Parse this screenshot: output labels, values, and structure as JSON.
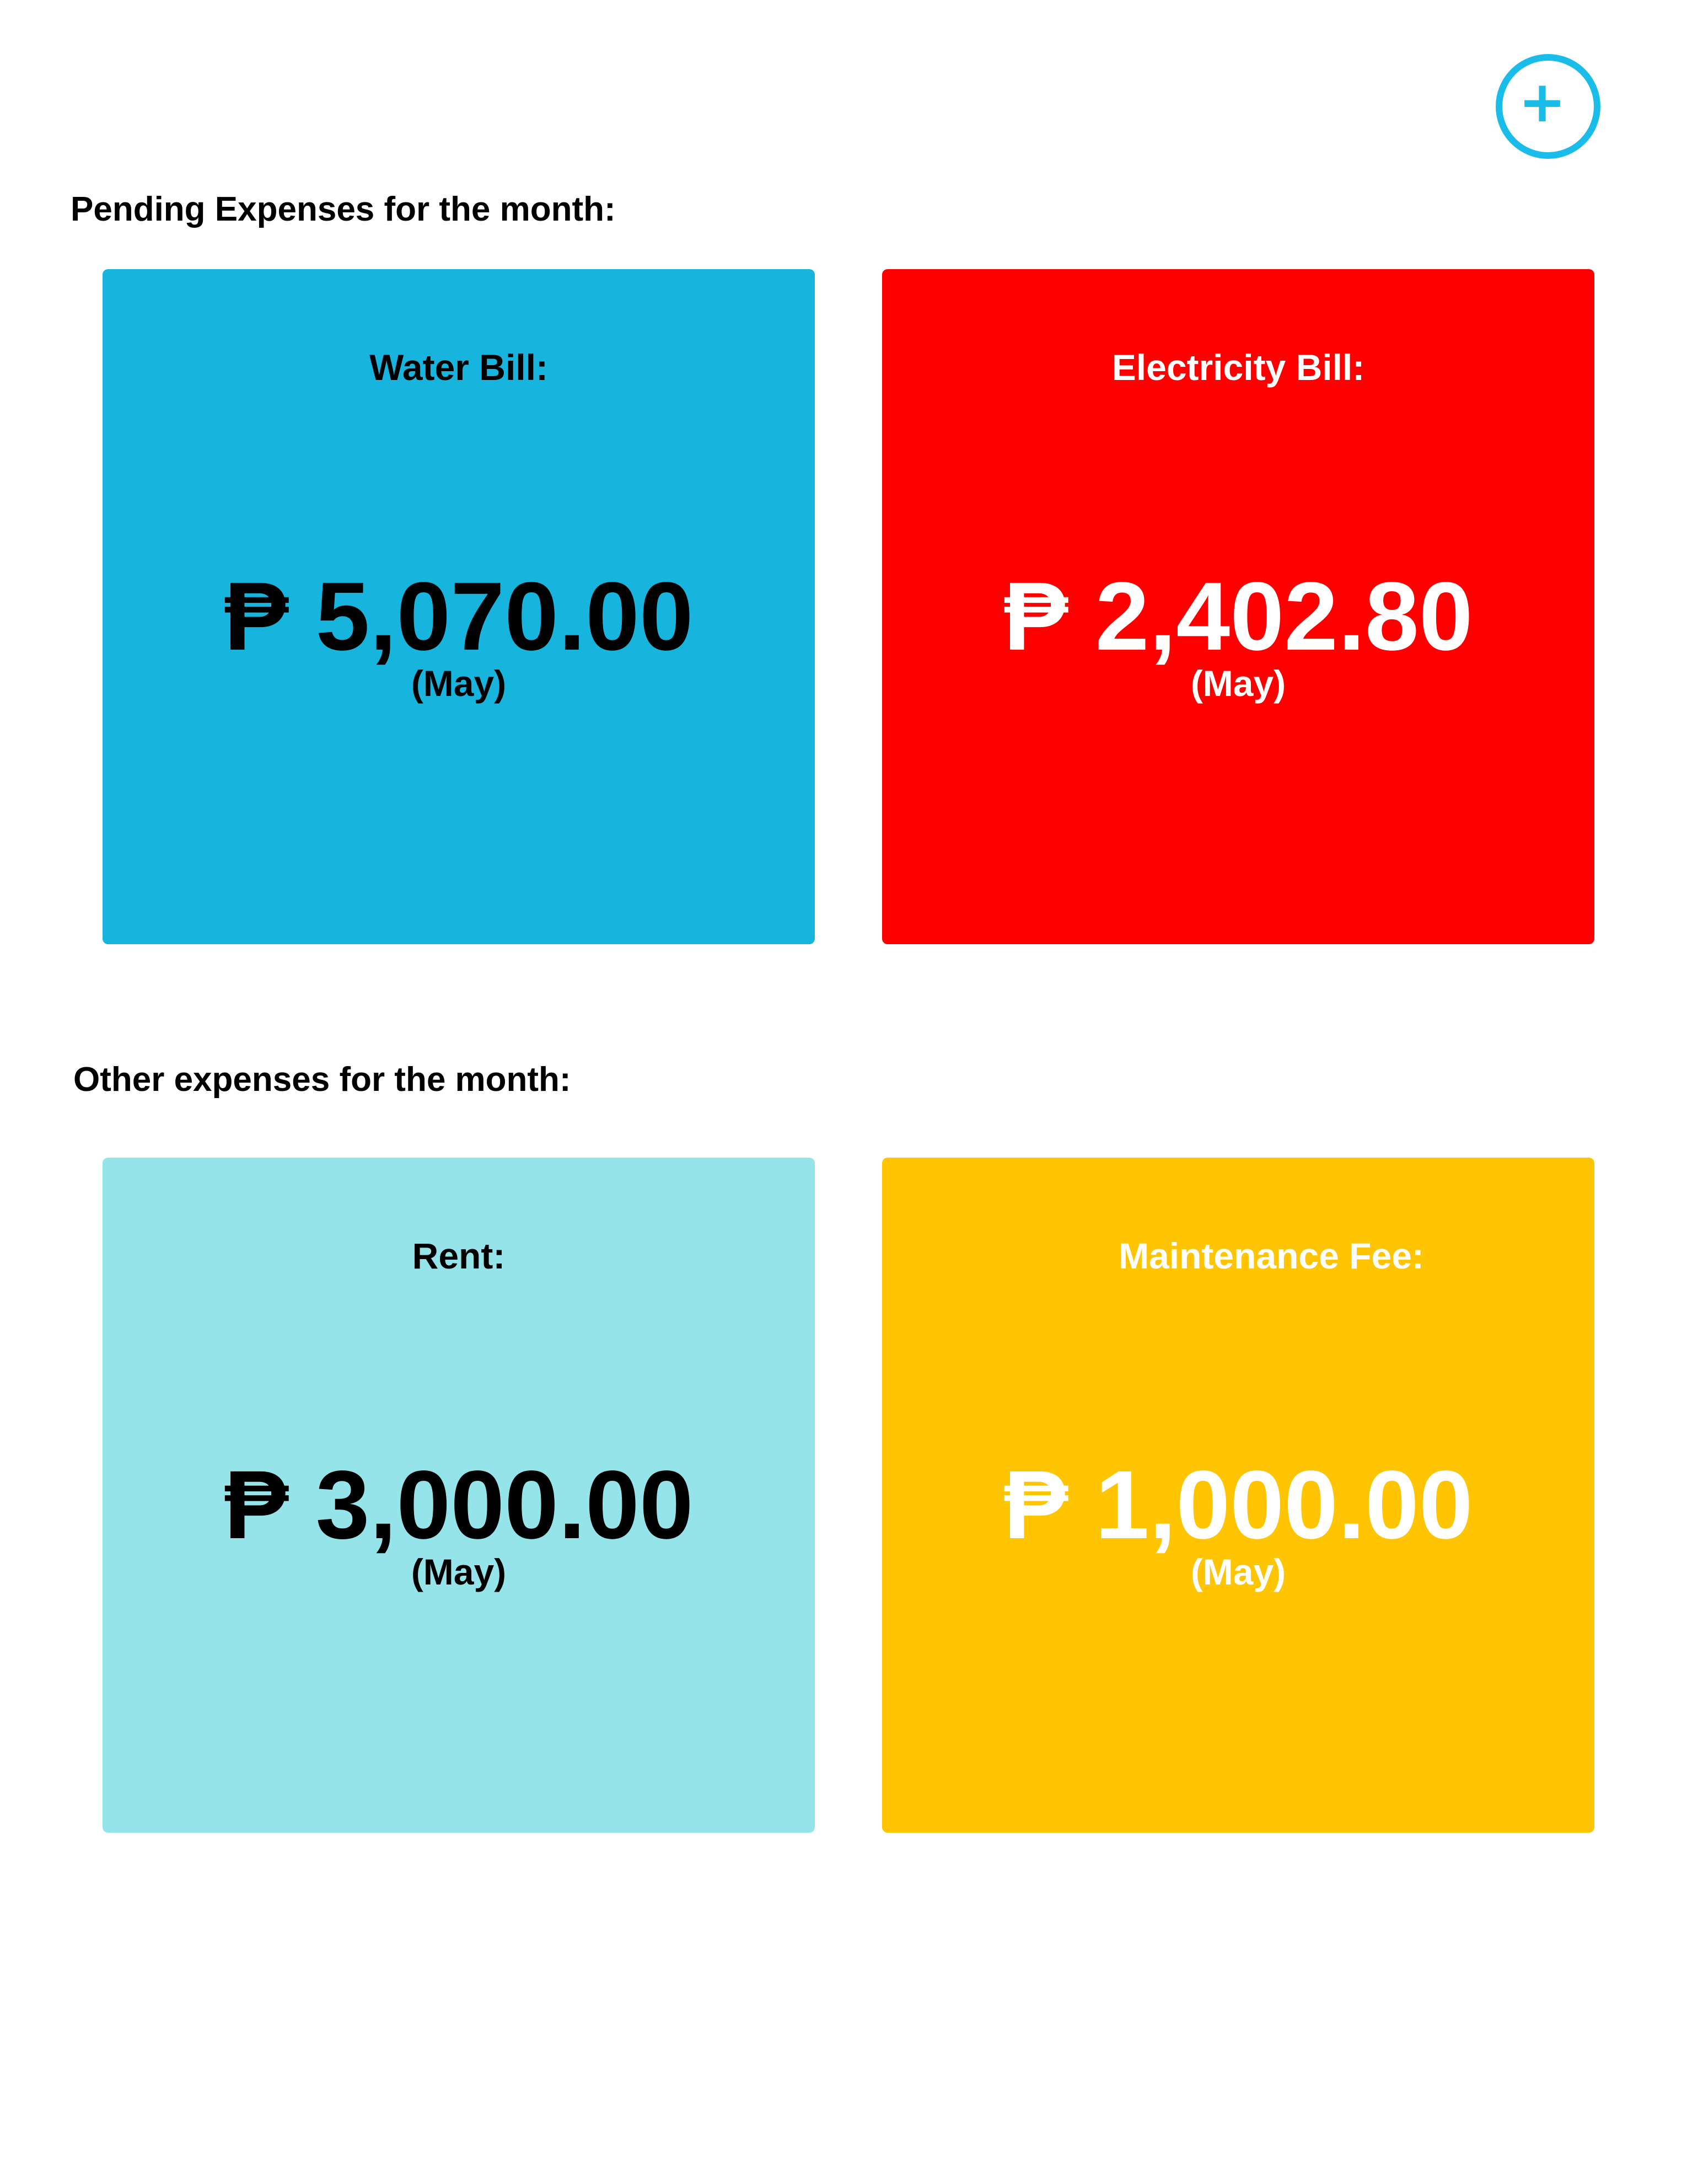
{
  "add_button": {
    "icon": "plus-icon",
    "color": "#1abcea"
  },
  "sections": {
    "pending": {
      "title": "Pending Expenses for the month:",
      "cards": [
        {
          "label": "Water Bill:",
          "amount": "₱ 5,070.00",
          "month": "(May)",
          "bg_color": "#17b4de",
          "text_color": "#000000"
        },
        {
          "label": "Electricity Bill:",
          "amount": "₱ 2,402.80",
          "month": "(May)",
          "bg_color": "#ff0000",
          "text_color": "#ffffff"
        }
      ]
    },
    "other": {
      "title": "Other expenses for the month:",
      "cards": [
        {
          "label": "Rent:",
          "amount": "₱ 3,000.00",
          "month": "(May)",
          "bg_color": "#94e4ea",
          "text_color": "#000000"
        },
        {
          "label": "Maintenance Fee:",
          "amount": "₱ 1,000.00",
          "month": "(May)",
          "bg_color": "#ffc402",
          "text_color": "#ffffff"
        }
      ]
    }
  }
}
